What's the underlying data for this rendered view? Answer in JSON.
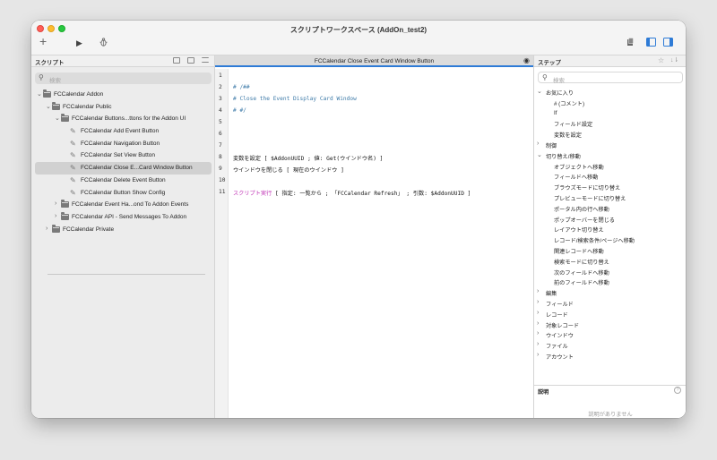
{
  "window": {
    "title": "スクリプトワークスペース (AddOn_test2)"
  },
  "toolbar": {
    "add_icon": "plus-icon",
    "run_icon": "play-icon",
    "debug_icon": "bug-icon",
    "right_icons": [
      "delete-icon",
      "toggle-left-pane-icon",
      "toggle-right-pane-icon"
    ]
  },
  "left_panel": {
    "title": "スクリプト",
    "search_placeholder": "検索",
    "tree": [
      {
        "label": "FCCalendar Addon",
        "level": 0,
        "type": "folder",
        "chevron": "down"
      },
      {
        "label": "FCCalendar Public",
        "level": 1,
        "type": "folder",
        "chevron": "down"
      },
      {
        "label": "FCCalendar Buttons...ttons for the Addon UI",
        "level": 2,
        "type": "folder",
        "chevron": "down"
      },
      {
        "label": "FCCalendar Add Event Button",
        "level": 3,
        "type": "script"
      },
      {
        "label": "FCCalendar Navigation Button",
        "level": 3,
        "type": "script"
      },
      {
        "label": "FCCalendar Set View Button",
        "level": 3,
        "type": "script"
      },
      {
        "label": "FCCalendar Close E...Card Window Button",
        "level": 3,
        "type": "script",
        "selected": true
      },
      {
        "label": "FCCalendar Delete Event Button",
        "level": 3,
        "type": "script"
      },
      {
        "label": "FCCalendar Button Show Config",
        "level": 3,
        "type": "script"
      },
      {
        "label": "FCCalendar Event Ha...ond To Addon Events",
        "level": 2,
        "type": "folder",
        "chevron": "right"
      },
      {
        "label": "FCCalendar API - Send Messages To Addon",
        "level": 2,
        "type": "folder",
        "chevron": "right"
      },
      {
        "label": "FCCalendar Private",
        "level": 1,
        "type": "folder",
        "chevron": "right"
      }
    ]
  },
  "editor": {
    "title": "FCCalendar Close Event Card Window Button",
    "lines": [
      {
        "num": "1",
        "text": "",
        "style": "step"
      },
      {
        "num": "2",
        "text": "# /##",
        "style": "comment"
      },
      {
        "num": "3",
        "text": "#  Close the Event Display Card Window",
        "style": "comment"
      },
      {
        "num": "4",
        "text": "#  #/",
        "style": "comment"
      },
      {
        "num": "5",
        "text": "",
        "style": "step"
      },
      {
        "num": "6",
        "text": "",
        "style": "step"
      },
      {
        "num": "7",
        "text": "",
        "style": "step"
      },
      {
        "num": "8",
        "text": "変数を設定 [ $AddonUUID ; 値: Get(ウインドウ名) ]",
        "style": "step"
      },
      {
        "num": "9",
        "text": "ウインドウを閉じる [ 現在のウインドウ ]",
        "style": "step"
      },
      {
        "num": "10",
        "text": "",
        "style": "step"
      },
      {
        "num": "11",
        "text_prefix": "スクリプト実行",
        "text": " [ 指定: 一覧から ; 「FCCalendar Refresh」 ; 引数: $AddonUUID ]",
        "style": "mixed"
      }
    ]
  },
  "right_panel": {
    "title": "ステップ",
    "search_placeholder": "検索",
    "items": [
      {
        "label": "お気に入り",
        "level": 0,
        "chevron": "down"
      },
      {
        "label": "# (コメント)",
        "level": 1
      },
      {
        "label": "If",
        "level": 1
      },
      {
        "label": "フィールド設定",
        "level": 1
      },
      {
        "label": "変数を設定",
        "level": 1
      },
      {
        "label": "制御",
        "level": 0,
        "chevron": "right"
      },
      {
        "label": "切り替え/移動",
        "level": 0,
        "chevron": "down"
      },
      {
        "label": "オブジェクトへ移動",
        "level": 1
      },
      {
        "label": "フィールドへ移動",
        "level": 1
      },
      {
        "label": "ブラウズモードに切り替え",
        "level": 1
      },
      {
        "label": "プレビューモードに切り替え",
        "level": 1
      },
      {
        "label": "ポータル内の行へ移動",
        "level": 1
      },
      {
        "label": "ポップオーバーを閉じる",
        "level": 1
      },
      {
        "label": "レイアウト切り替え",
        "level": 1
      },
      {
        "label": "レコード/検索条件/ページへ移動",
        "level": 1
      },
      {
        "label": "関連レコードへ移動",
        "level": 1
      },
      {
        "label": "検索モードに切り替え",
        "level": 1
      },
      {
        "label": "次のフィールドへ移動",
        "level": 1
      },
      {
        "label": "前のフィールドへ移動",
        "level": 1
      },
      {
        "label": "編集",
        "level": 0,
        "chevron": "right"
      },
      {
        "label": "フィールド",
        "level": 0,
        "chevron": "right"
      },
      {
        "label": "レコード",
        "level": 0,
        "chevron": "right"
      },
      {
        "label": "対象レコード",
        "level": 0,
        "chevron": "right"
      },
      {
        "label": "ウインドウ",
        "level": 0,
        "chevron": "right"
      },
      {
        "label": "ファイル",
        "level": 0,
        "chevron": "right"
      },
      {
        "label": "アカウント",
        "level": 0,
        "chevron": "right"
      }
    ],
    "description": {
      "title": "説明",
      "empty_text": "説明がありません"
    }
  },
  "colors": {
    "accent": "#2e7bd6",
    "comment": "#3d7aa8",
    "script_call": "#c035b6",
    "selected_row": "#d1d1d1"
  }
}
